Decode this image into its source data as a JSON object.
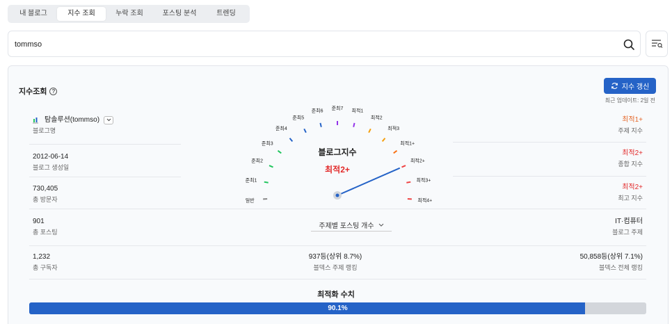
{
  "tabs": [
    {
      "label": "내 블로그",
      "active": false
    },
    {
      "label": "지수 조회",
      "active": true
    },
    {
      "label": "누락 조회",
      "active": false
    },
    {
      "label": "포스팅 분석",
      "active": false
    },
    {
      "label": "트렌딩",
      "active": false
    }
  ],
  "search": {
    "value": "tommso"
  },
  "card": {
    "title": "지수조회",
    "refresh_label": "지수 갱신",
    "updated": "최근 업데이트:  2일 전"
  },
  "blog": {
    "name": "탐솔루션(tommso)",
    "name_label": "블로그명",
    "created": "2012-06-14",
    "created_label": "블로그 생성일",
    "visitors": "730,405",
    "visitors_label": "총 방문자",
    "posts": "901",
    "posts_label": "총 포스팅",
    "subscribers": "1,232",
    "subscribers_label": "총 구독자"
  },
  "indices": {
    "topic": "최적1+",
    "topic_label": "주제 지수",
    "overall": "최적2+",
    "overall_label": "종합 지수",
    "max": "최적2+",
    "max_label": "최고 지수",
    "category": "IT·컴퓨터",
    "category_label": "블로그 주제",
    "total_rank": "50,858등(상위 7.1%)",
    "total_rank_label": "블덱스 전체 랭킹"
  },
  "gauge": {
    "title": "블로그지수",
    "value": "최적2+",
    "value_index": 12,
    "levels": [
      {
        "label": "일반",
        "color": "#888888"
      },
      {
        "label": "준최1",
        "color": "#22c55e"
      },
      {
        "label": "준최2",
        "color": "#22c55e"
      },
      {
        "label": "준최3",
        "color": "#22c55e"
      },
      {
        "label": "준최4",
        "color": "#2563c7"
      },
      {
        "label": "준최5",
        "color": "#2563c7"
      },
      {
        "label": "준최6",
        "color": "#2563c7"
      },
      {
        "label": "준최7",
        "color": "#9333ea"
      },
      {
        "label": "최적1",
        "color": "#9333ea"
      },
      {
        "label": "최적2",
        "color": "#f59e0b"
      },
      {
        "label": "최적3",
        "color": "#f59e0b"
      },
      {
        "label": "최적1+",
        "color": "#f97316"
      },
      {
        "label": "최적2+",
        "color": "#ef4444"
      },
      {
        "label": "최적3+",
        "color": "#ef4444"
      },
      {
        "label": "최적4+",
        "color": "#ef4444"
      }
    ]
  },
  "topic_select": {
    "label": "주제별 포스팅 개수"
  },
  "topic_rank": {
    "value": "937등(상위 8.7%)",
    "label": "블덱스 주제 랭킹"
  },
  "optimization": {
    "title": "최적화 수치",
    "value": "90.1%",
    "fraction": 0.901
  },
  "colors": {
    "accent": "#2563c7",
    "red": "#e22a2a",
    "orange": "#e5692c"
  }
}
